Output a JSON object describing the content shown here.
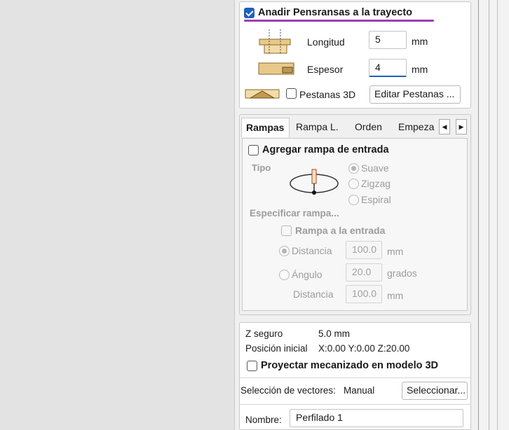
{
  "tabs_section": {
    "add_tabs_label": "Anadir Pensransas a la trayecto",
    "add_tabs_checked": true,
    "length_label": "Longitud",
    "length_value": "5",
    "length_unit": "mm",
    "thickness_label": "Espesor",
    "thickness_value": "4",
    "thickness_unit": "mm",
    "tabs3d_label": "Pestanas 3D",
    "edit_tabs_button": "Editar Pestanas ..."
  },
  "tabs": [
    "Rampas",
    "Rampa L.",
    "Orden",
    "Empeza"
  ],
  "ramps": {
    "add_ramp_label": "Agregar rampa de entrada",
    "type_label": "Tipo",
    "type_options": [
      "Suave",
      "Zigzag",
      "Espiral"
    ],
    "specify_label": "Especificar rampa...",
    "ramp_at_entry_label": "Rampa a la entrada",
    "distance_label": "Distancia",
    "distance_value": "100.0",
    "distance_unit": "mm",
    "angle_label": "Ángulo",
    "angle_value": "20.0",
    "angle_unit": "grados",
    "distance2_label": "Distancia",
    "distance2_value": "100.0",
    "distance2_unit": "mm"
  },
  "info": {
    "safe_z_label": "Z seguro",
    "safe_z_value": "5.0 mm",
    "home_label": "Posición inicial",
    "home_value": "X:0.00 Y:0.00 Z:20.00",
    "project_label": "Proyectar mecanizado en modelo 3D"
  },
  "selection": {
    "label": "Selección de vectores:",
    "value": "Manual",
    "button": "Seleccionar..."
  },
  "name": {
    "label": "Nombre:",
    "value": "Perfilado 1"
  },
  "colors": {
    "accent": "#1f5fbf",
    "underline": "#9b3fb0"
  }
}
